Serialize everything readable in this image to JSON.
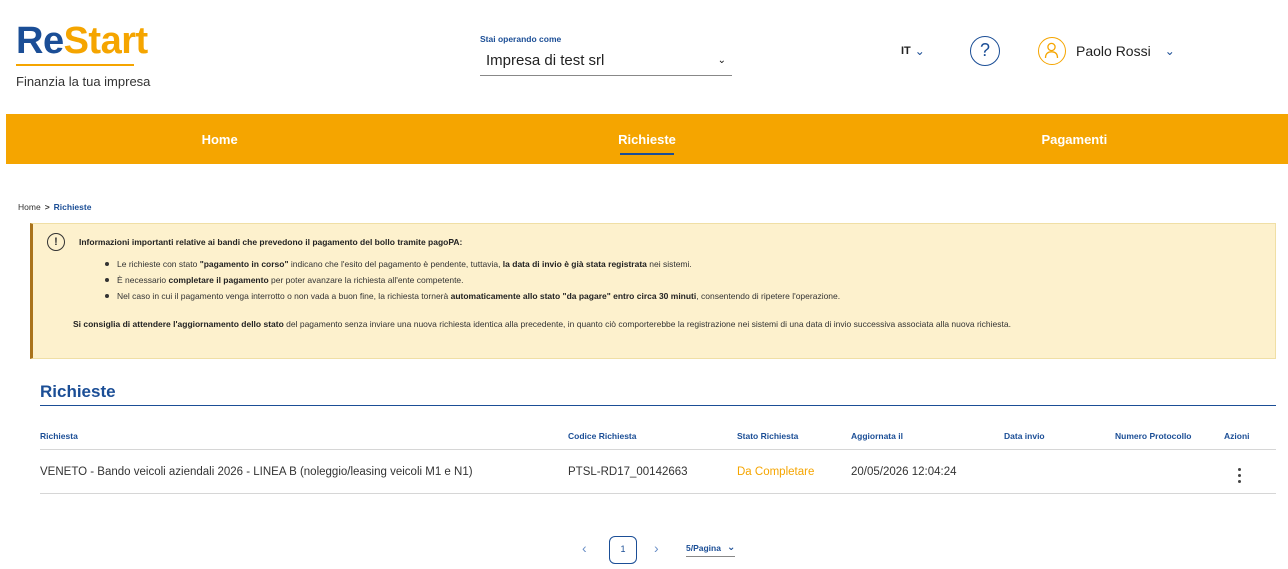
{
  "brand": {
    "logo_re": "Re",
    "logo_start": "Start",
    "tagline": "Finanzia la tua impresa"
  },
  "header": {
    "operating_label": "Stai operando come",
    "company": "Impresa di test srl",
    "language": "IT",
    "help_symbol": "?",
    "user_name": "Paolo Rossi"
  },
  "nav": {
    "items": [
      {
        "label": "Home",
        "active": false
      },
      {
        "label": "Richieste",
        "active": true
      },
      {
        "label": "Pagamenti",
        "active": false
      }
    ]
  },
  "breadcrumb": {
    "home": "Home",
    "separator": ">",
    "current": "Richieste"
  },
  "alert": {
    "icon": "!",
    "title": "Informazioni importanti relative ai bandi che prevedono il pagamento del bollo tramite pagoPA:",
    "b1_p1": "Le richieste con stato ",
    "b1_b1": "\"pagamento in corso\"",
    "b1_p2": " indicano che l'esito del pagamento è pendente, tuttavia, ",
    "b1_b2": "la data di invio è già stata registrata",
    "b1_p3": " nei sistemi.",
    "b2_p1": "È necessario ",
    "b2_b1": "completare il pagamento",
    "b2_p2": " per poter avanzare la richiesta all'ente competente.",
    "b3_p1": "Nel caso in cui il pagamento venga interrotto o non vada a buon fine, la richiesta tornerà ",
    "b3_b1": "automaticamente allo stato \"da pagare\" entro circa 30 minuti",
    "b3_p2": ", consentendo di ripetere l'operazione.",
    "foot_b": "Si consiglia di attendere l'aggiornamento dello stato",
    "foot_p": " del pagamento senza inviare una nuova richiesta identica alla precedente, in quanto ciò comporterebbe la registrazione nei sistemi di una data di invio successiva associata alla nuova richiesta."
  },
  "section": {
    "title": "Richieste"
  },
  "table": {
    "headers": [
      "Richiesta",
      "Codice Richiesta",
      "Stato Richiesta",
      "Aggiornata il",
      "Data invio",
      "Numero Protocollo",
      "Azioni"
    ],
    "rows": [
      {
        "richiesta": "VENETO - Bando veicoli aziendali 2026 - LINEA B (noleggio/leasing veicoli M1 e N1)",
        "codice": "PTSL-RD17_00142663",
        "stato": "Da Completare",
        "aggiornata": "20/05/2026 12:04:24",
        "data_invio": "",
        "protocollo": ""
      }
    ]
  },
  "pagination": {
    "current_page": "1",
    "page_size": "5/Pagina"
  },
  "colors": {
    "primary": "#1b4e96",
    "accent": "#f5a500",
    "alert_bg": "#fdf1cd"
  }
}
